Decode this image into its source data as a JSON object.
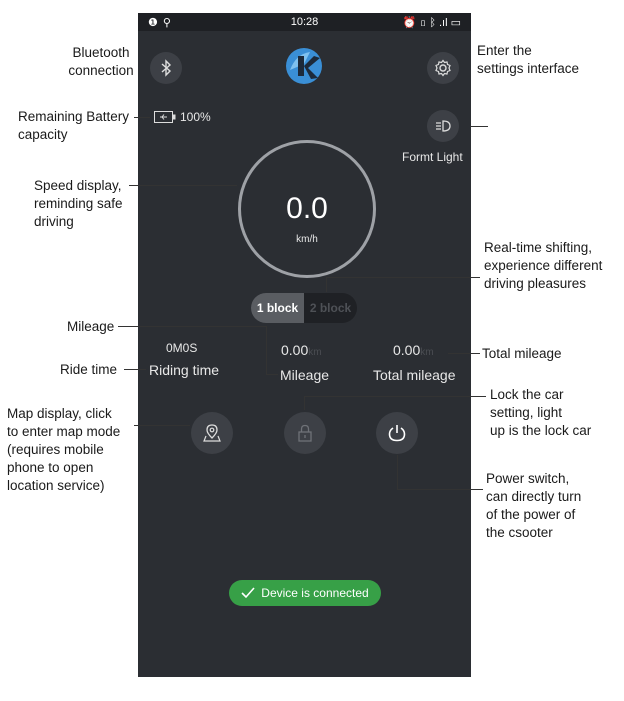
{
  "status_bar": {
    "left_icons": "❶ ⚲",
    "time": "10:28",
    "right_icons": "⏰ ▯ ᛒ .ıl ▭"
  },
  "header": {
    "logo_icon": "k-logo-icon",
    "bluetooth_icon": "bluetooth-icon",
    "settings_icon": "gear-icon"
  },
  "battery": {
    "icon": "battery-icon",
    "value": "100%"
  },
  "light": {
    "icon": "headlight-icon",
    "label": "Formt Light"
  },
  "speed": {
    "value": "0.0",
    "unit": "km/h"
  },
  "gear": {
    "option1": "1 block",
    "option2": "2 block",
    "selected": "1 block"
  },
  "stats": {
    "ride_time_value": "0M0S",
    "ride_time_label": "Riding time",
    "mileage_value": "0.00",
    "mileage_unit": "km",
    "mileage_label": "Mileage",
    "total_value": "0.00",
    "total_unit": "km",
    "total_label": "Total mileage"
  },
  "controls": {
    "map_icon": "map-pin-icon",
    "lock_icon": "lock-icon",
    "power_icon": "power-icon"
  },
  "toast": {
    "icon": "check-icon",
    "text": "Device is connected"
  },
  "annotations": {
    "bluetooth": [
      "Bluetooth",
      "connection"
    ],
    "settings": [
      "Enter the",
      "settings interface"
    ],
    "battery": [
      "Remaining Battery",
      "capacity"
    ],
    "speed": [
      "Speed display,",
      "reminding safe",
      "driving"
    ],
    "shifting": [
      "Real-time shifting,",
      "experience different",
      "driving pleasures"
    ],
    "mileage": "Mileage",
    "ride_time": "Ride time",
    "total_mileage": "Total mileage",
    "lock": [
      "Lock the car",
      "setting, light",
      "up is the lock car"
    ],
    "map": [
      "Map display, click",
      "to enter map mode",
      "(requires mobile",
      "phone to open",
      "location service)"
    ],
    "power": [
      "Power switch,",
      "can directly turn",
      "of the power of",
      "the csooter"
    ]
  },
  "colors": {
    "phone_bg": "#2b2e33",
    "button_bg": "#3d4046",
    "toast_green": "#37a047",
    "logo_blue": "#3a8fd6"
  }
}
